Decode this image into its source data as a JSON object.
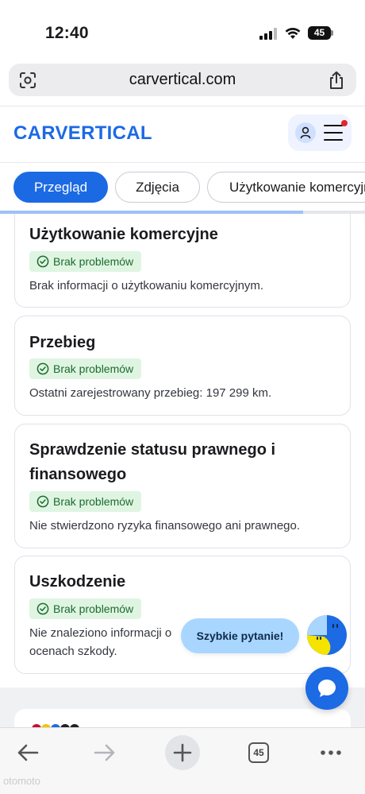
{
  "status_bar": {
    "time": "12:40",
    "battery": "45"
  },
  "browser": {
    "url": "carvertical.com"
  },
  "header": {
    "logo_text": "CARVERTICAL",
    "brand_color": "#1c6ae4"
  },
  "tabs": [
    {
      "label": "Przegląd",
      "active": true
    },
    {
      "label": "Zdjęcia",
      "active": false
    },
    {
      "label": "Użytkowanie komercyjne",
      "active": false
    }
  ],
  "scroll_progress": 0.83,
  "cards": [
    {
      "title": "Użytkowanie komercyjne",
      "badge": "Brak problemów",
      "text": "Brak informacji o użytkowaniu komercyjnym."
    },
    {
      "title": "Przebieg",
      "badge": "Brak problemów",
      "text": "Ostatni zarejestrowany przebieg: 197 299 km."
    },
    {
      "title_line1": "Sprawdzenie statusu prawnego i",
      "title_line2": "finansowego",
      "badge": "Brak problemów",
      "text": "Nie stwierdzono ryzyka finansowego ani prawnego."
    },
    {
      "title": "Uszkodzenie",
      "badge": "Brak problemów",
      "text_line1": "Nie znaleziono informacji o",
      "text_line2": "ocenach szkody."
    }
  ],
  "chat": {
    "quick_question": "Szybkie pytanie!"
  },
  "toolbar": {
    "tabs_count": "45"
  },
  "watermark": "otomoto",
  "colors": {
    "accent": "#1b6ae4",
    "badge_bg": "#dff5e2",
    "badge_text": "#1c6b2f",
    "notification": "#e0252b"
  },
  "icons": [
    "page-settings-icon",
    "share-icon",
    "user-icon",
    "menu-icon",
    "check-circle-icon",
    "chat-icon",
    "back-icon",
    "forward-icon",
    "plus-icon",
    "tabs-icon",
    "more-icon"
  ]
}
